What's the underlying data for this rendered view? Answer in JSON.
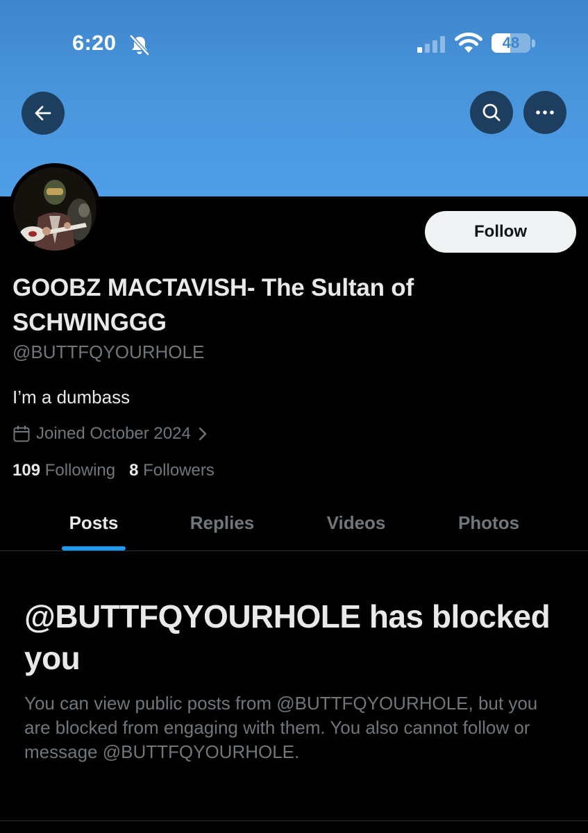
{
  "status_bar": {
    "time": "6:20",
    "battery_level": "48",
    "battery_fraction": 0.48,
    "icons": [
      "bell-slash-icon",
      "signal-icon",
      "wifi-icon",
      "battery-icon"
    ]
  },
  "header": {
    "back_icon": "arrow-left-icon",
    "search_icon": "search-icon",
    "more_icon": "more-horizontal-icon",
    "banner_color": "#4a97de"
  },
  "profile": {
    "display_name": "GOOBZ MACTAVISH- The Sultan of SCHWINGGG",
    "handle": "@BUTTFQYOURHOLE",
    "bio": "I’m a dumbass",
    "joined": "Joined October 2024",
    "following_count": "109",
    "following_label": "Following",
    "followers_count": "8",
    "followers_label": "Followers",
    "follow_button": "Follow"
  },
  "tabs": [
    {
      "label": "Posts",
      "active": true
    },
    {
      "label": "Replies",
      "active": false
    },
    {
      "label": "Videos",
      "active": false
    },
    {
      "label": "Photos",
      "active": false
    }
  ],
  "blocked_notice": {
    "title": "@BUTTFQYOURHOLE has blocked you",
    "description": "You can view public posts from @BUTTFQYOURHOLE, but you are blocked from engaging with them. You also cannot follow or message @BUTTFQYOURHOLE."
  },
  "colors": {
    "accent": "#1d9bf0",
    "background": "#000000",
    "text_primary": "#e7e9ea",
    "text_secondary": "#71767b"
  }
}
